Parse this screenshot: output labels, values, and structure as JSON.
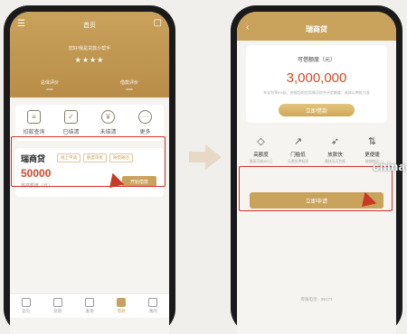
{
  "left": {
    "header_title": "首页",
    "account_text": "您好!我是贷款小帮手",
    "stars": "★★★★",
    "stats": [
      {
        "label": "总体评价",
        "value": "****"
      },
      {
        "label": "借款评价",
        "value": "****"
      }
    ],
    "quick_actions": [
      {
        "label": "扣款查询",
        "icon": "document-icon",
        "glyph": "≡"
      },
      {
        "label": "已结清",
        "icon": "clipboard-icon",
        "glyph": "✓"
      },
      {
        "label": "未结清",
        "icon": "coins-icon",
        "glyph": "¥"
      },
      {
        "label": "更多",
        "icon": "more-icon",
        "glyph": "···"
      }
    ],
    "loan_card": {
      "name": "瑞商贷",
      "tags": [
        "线上申请",
        "额度审批",
        "随借随还"
      ],
      "amount": "50000",
      "subtitle": "最高额度（元）",
      "button": "开始借款"
    },
    "tabs": [
      {
        "label": "首页",
        "icon": "home-icon"
      },
      {
        "label": "贷款",
        "icon": "gear-icon"
      },
      {
        "label": "发现",
        "icon": "flower-icon"
      },
      {
        "label": "借款",
        "icon": "wallet-icon"
      },
      {
        "label": "我的",
        "icon": "user-icon"
      }
    ]
  },
  "right": {
    "back_glyph": "‹",
    "title": "瑞商贷",
    "limit_label": "可借额度（元）",
    "limit_amount": "3,000,000",
    "limit_note": "年化利率8%起，依据您的信用情况综合评定额度，具体以审批为准",
    "limit_button": "立即借款",
    "features": [
      {
        "title": "高额度",
        "sub": "最高可借300万",
        "icon": "diamond-icon",
        "glyph": "◇"
      },
      {
        "title": "门槛低",
        "sub": "无需抵押担保",
        "icon": "trend-icon",
        "glyph": "↗"
      },
      {
        "title": "放款快",
        "sub": "最快当天到账",
        "icon": "rocket-icon",
        "glyph": "➶"
      },
      {
        "title": "更便捷",
        "sub": "随借随还",
        "icon": "cycle-icon",
        "glyph": "⇅"
      }
    ],
    "apply_button": "立即申请",
    "service": "客服电话：95173"
  },
  "watermark": "china",
  "colors": {
    "accent": "#c9a25c",
    "amount": "#d04a2a",
    "highlight": "#d0312d"
  }
}
